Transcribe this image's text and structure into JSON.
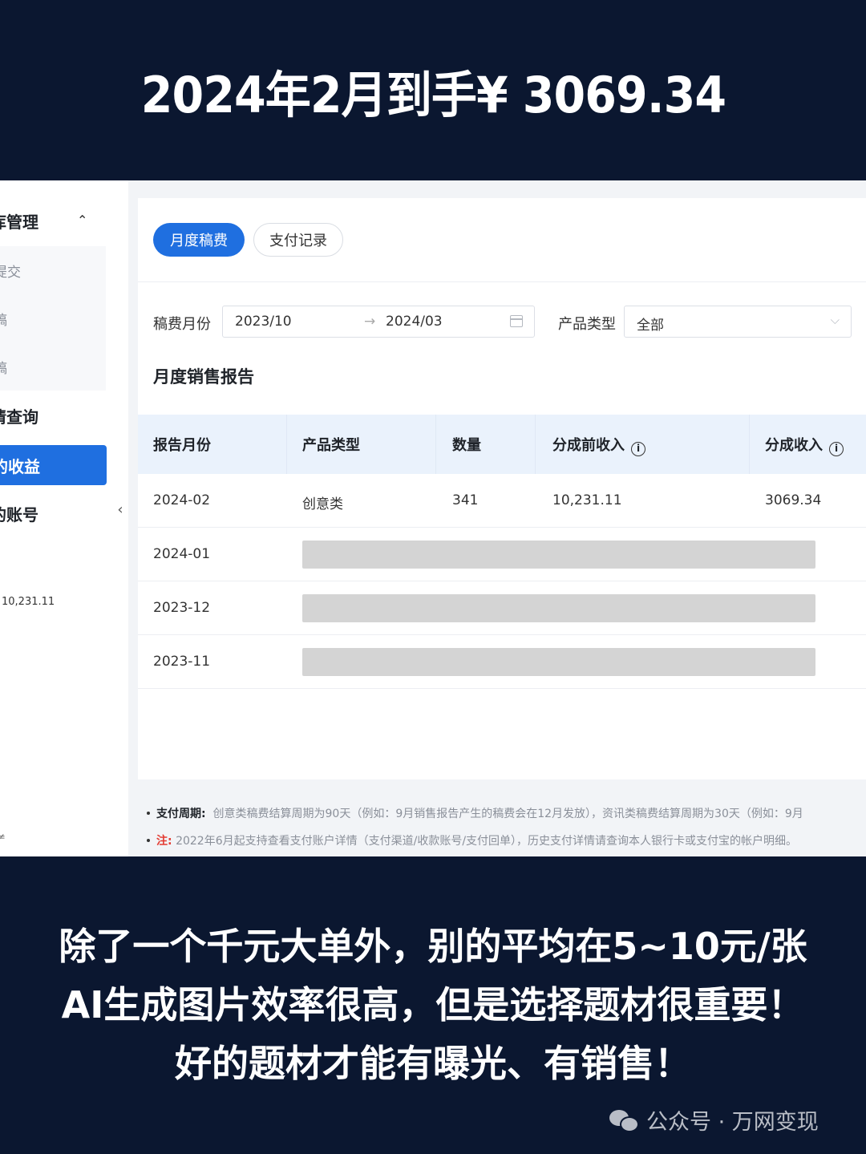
{
  "banner": {
    "title": "2024年2月到手¥ 3069.34"
  },
  "sidebar": {
    "section1": "库管理",
    "sub_items": [
      "提交",
      "稿",
      "稿"
    ],
    "item_query": "情查询",
    "item_active": "的收益",
    "item_account": "的账号",
    "amount": "10,231.11",
    "footer": "≠"
  },
  "tabs": [
    {
      "label": "月度稿费",
      "active": true
    },
    {
      "label": "支付记录",
      "active": false
    }
  ],
  "filters": {
    "month_label": "稿费月份",
    "month_start": "2023/10",
    "month_end": "2024/03",
    "type_label": "产品类型",
    "type_value": "全部"
  },
  "report": {
    "title": "月度销售报告",
    "headers": [
      "报告月份",
      "产品类型",
      "数量",
      "分成前收入",
      "分成收入"
    ],
    "rows": [
      {
        "month": "2024-02",
        "type": "创意类",
        "qty": "341",
        "pre": "10,231.11",
        "income": "3069.34",
        "masked": false
      },
      {
        "month": "2024-01",
        "masked": true
      },
      {
        "month": "2023-12",
        "masked": true
      },
      {
        "month": "2023-11",
        "masked": true
      }
    ]
  },
  "notes": {
    "cycle_label": "支付周期:",
    "cycle_text": "创意类稿费结算周期为90天（例如：9月销售报告产生的稿费会在12月发放），资讯类稿费结算周期为30天（例如：9月",
    "note_label": "注:",
    "note_text": "2022年6月起支持查看支付账户详情（支付渠道/收款账号/支付回单），历史支付详情请查询本人银行卡或支付宝的帐户明细。"
  },
  "bottom": {
    "line1": "除了一个千元大单外，别的平均在5~10元/张",
    "line2": "AI生成图片效率很高，但是选择题材很重要！",
    "line3": "好的题材才能有曝光、有销售！"
  },
  "watermark": {
    "text": "公众号 · 万网变现"
  }
}
